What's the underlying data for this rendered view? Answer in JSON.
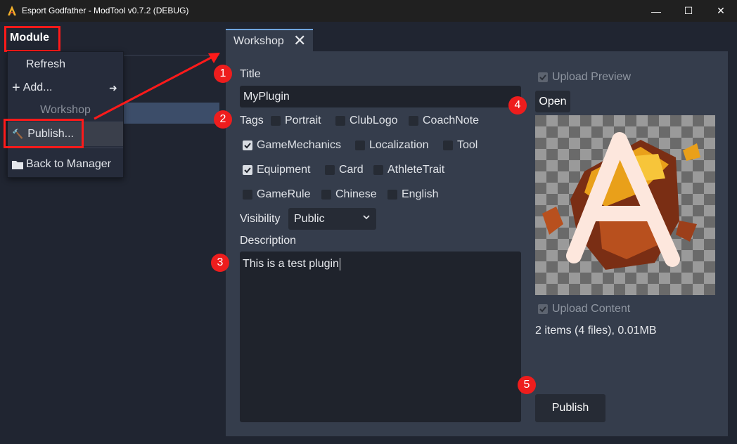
{
  "window": {
    "title": "Esport Godfather - ModTool v0.7.2 (DEBUG)",
    "controls": {
      "minimize": "—",
      "maximize": "☐",
      "close": "✕"
    }
  },
  "menu": {
    "module_label": "Module"
  },
  "popup": {
    "refresh": "Refresh",
    "add": "Add...",
    "section_workshop": "Workshop",
    "publish": "Publish...",
    "back": "Back to Manager"
  },
  "tab": {
    "label": "Workshop",
    "close": "✕"
  },
  "form": {
    "title_label": "Title",
    "title_value": "MyPlugin",
    "tags_label": "Tags",
    "tags": [
      {
        "label": "Portrait",
        "checked": false
      },
      {
        "label": "ClubLogo",
        "checked": false
      },
      {
        "label": "CoachNote",
        "checked": false
      },
      {
        "label": "GameMechanics",
        "checked": true
      },
      {
        "label": "Localization",
        "checked": false
      },
      {
        "label": "Tool",
        "checked": false
      },
      {
        "label": "Equipment",
        "checked": true
      },
      {
        "label": "Card",
        "checked": false
      },
      {
        "label": "AthleteTrait",
        "checked": false
      },
      {
        "label": "GameRule",
        "checked": false
      },
      {
        "label": "Chinese",
        "checked": false
      },
      {
        "label": "English",
        "checked": false
      }
    ],
    "visibility_label": "Visibility",
    "visibility_value": "Public",
    "description_label": "Description",
    "description_value": "This is a test plugin"
  },
  "right": {
    "upload_preview": "Upload Preview",
    "open_button": "Open",
    "upload_content": "Upload Content",
    "content_summary": "2 items (4 files), 0.01MB",
    "publish_button": "Publish"
  },
  "annotations": {
    "badges": [
      "1",
      "2",
      "3",
      "4",
      "5"
    ],
    "color": "#ff1a1a"
  },
  "colors": {
    "panel": "#353d4c",
    "background": "#202531",
    "tab_accent": "#70a6e0",
    "selection": "#3c4d69"
  }
}
